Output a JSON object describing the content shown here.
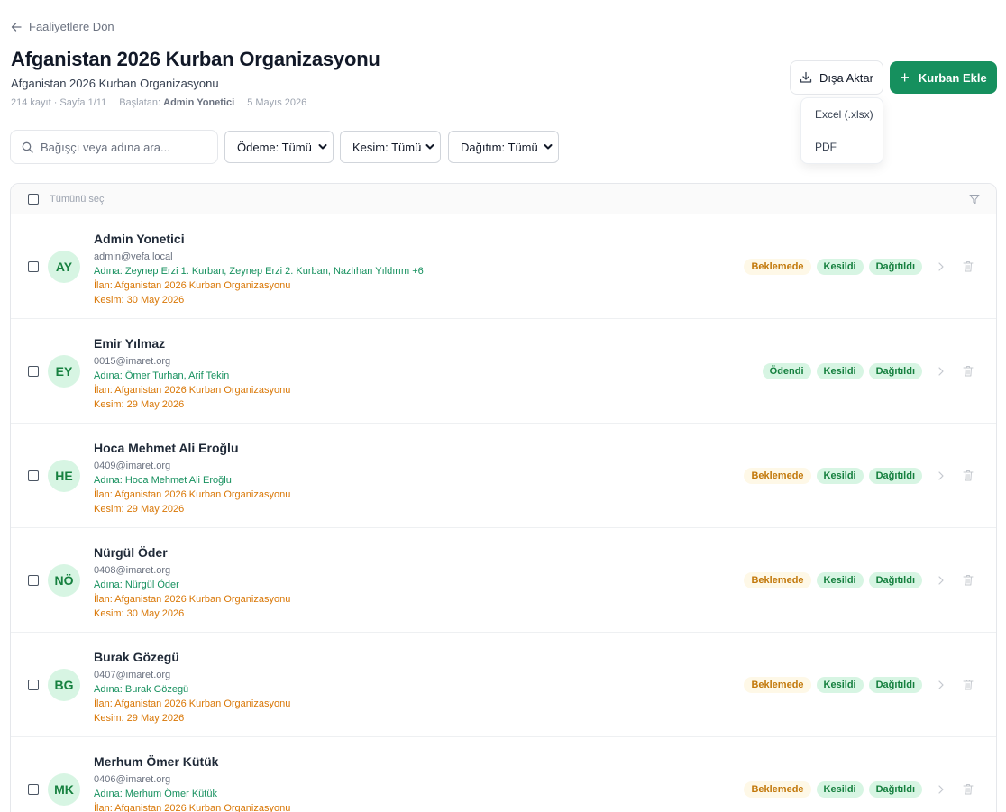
{
  "nav": {
    "back_label": "Faaliyetlere Dön"
  },
  "header": {
    "title": "Afganistan 2026 Kurban Organizasyonu",
    "subtitle": "Afganistan 2026 Kurban Organizasyonu",
    "meta": {
      "count_text": "214 kayıt · Sayfa 1/11",
      "started_label": "Başlatan:",
      "started_by": "Admin Yonetici",
      "date": "5 Mayıs 2026"
    }
  },
  "actions": {
    "export_label": "Dışa Aktar",
    "add_label": "Kurban Ekle",
    "export_menu": [
      "Excel (.xlsx)",
      "PDF"
    ]
  },
  "filters": {
    "search_placeholder": "Bağışçı veya adına ara...",
    "payment": "Ödeme: Tümü",
    "slaughter": "Kesim: Tümü",
    "distribution": "Dağıtım: Tümü"
  },
  "list": {
    "select_all_label": "Tümünü seç",
    "rows": [
      {
        "initials": "AY",
        "name": "Admin Yonetici",
        "email": "admin@vefa.local",
        "on_behalf": "Adına: Zeynep Erzi 1. Kurban, Zeynep Erzi 2. Kurban, Nazlıhan Yıldırım +6",
        "listing": "İlan: Afganistan 2026 Kurban Organizasyonu",
        "slaughter_date": "Kesim: 30 May 2026",
        "payment": "Beklemede",
        "payment_state": "pending",
        "slaughter_status": "Kesildi",
        "distribution": "Dağıtıldı"
      },
      {
        "initials": "EY",
        "name": "Emir Yılmaz",
        "email": "0015@imaret.org",
        "on_behalf": "Adına: Ömer Turhan, Arif Tekin",
        "listing": "İlan: Afganistan 2026 Kurban Organizasyonu",
        "slaughter_date": "Kesim: 29 May 2026",
        "payment": "Ödendi",
        "payment_state": "paid",
        "slaughter_status": "Kesildi",
        "distribution": "Dağıtıldı"
      },
      {
        "initials": "HE",
        "name": "Hoca Mehmet Ali Eroğlu",
        "email": "0409@imaret.org",
        "on_behalf": "Adına: Hoca Mehmet Ali Eroğlu",
        "listing": "İlan: Afganistan 2026 Kurban Organizasyonu",
        "slaughter_date": "Kesim: 29 May 2026",
        "payment": "Beklemede",
        "payment_state": "pending",
        "slaughter_status": "Kesildi",
        "distribution": "Dağıtıldı"
      },
      {
        "initials": "NÖ",
        "name": "Nürgül Öder",
        "email": "0408@imaret.org",
        "on_behalf": "Adına: Nürgül Öder",
        "listing": "İlan: Afganistan 2026 Kurban Organizasyonu",
        "slaughter_date": "Kesim: 30 May 2026",
        "payment": "Beklemede",
        "payment_state": "pending",
        "slaughter_status": "Kesildi",
        "distribution": "Dağıtıldı"
      },
      {
        "initials": "BG",
        "name": "Burak Gözegü",
        "email": "0407@imaret.org",
        "on_behalf": "Adına: Burak Gözegü",
        "listing": "İlan: Afganistan 2026 Kurban Organizasyonu",
        "slaughter_date": "Kesim: 29 May 2026",
        "payment": "Beklemede",
        "payment_state": "pending",
        "slaughter_status": "Kesildi",
        "distribution": "Dağıtıldı"
      },
      {
        "initials": "MK",
        "name": "Merhum Ömer Kütük",
        "email": "0406@imaret.org",
        "on_behalf": "Adına: Merhum Ömer Kütük",
        "listing": "İlan: Afganistan 2026 Kurban Organizasyonu",
        "slaughter_date": "",
        "payment": "Beklemede",
        "payment_state": "pending",
        "slaughter_status": "Kesildi",
        "distribution": "Dağıtıldı"
      }
    ]
  },
  "colors": {
    "brand_green": "#16905e",
    "pending_text": "#c2780a",
    "pending_bg": "#fef8e7",
    "success_text": "#16803f",
    "success_bg": "#d7f5e3",
    "listing_text": "#d97706"
  },
  "icons": {
    "back": "arrow-left-icon",
    "export": "download-icon",
    "add": "plus-icon",
    "search": "search-icon",
    "filter": "funnel-icon",
    "row_open": "chevron-right-icon",
    "row_delete": "trash-icon"
  }
}
